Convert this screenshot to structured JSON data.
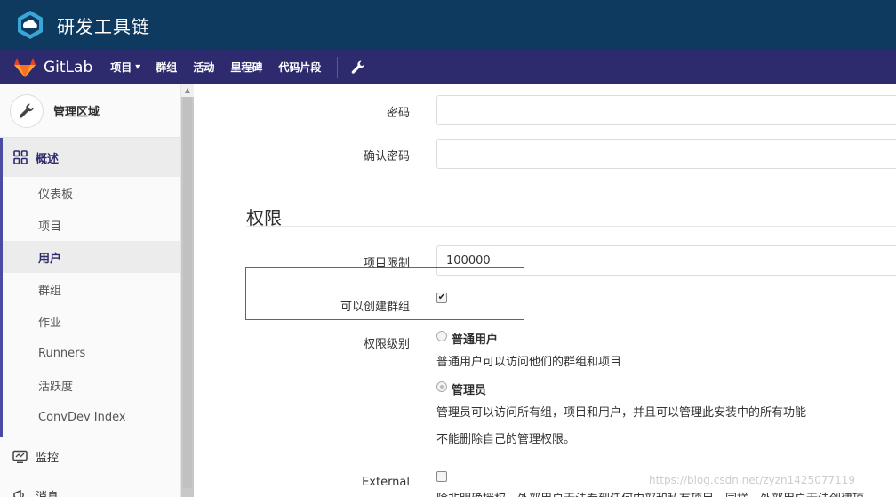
{
  "brand": {
    "title": "研发工具链",
    "logo_icon": "cloud-hexagon-icon"
  },
  "nav": {
    "app_name": "GitLab",
    "items": [
      {
        "label": "项目",
        "has_dropdown": true
      },
      {
        "label": "群组"
      },
      {
        "label": "活动"
      },
      {
        "label": "里程碑"
      },
      {
        "label": "代码片段"
      }
    ],
    "admin_icon": "wrench-icon",
    "colors": {
      "brandbar": "#0d3a5e",
      "navbar": "#2d2a6e"
    }
  },
  "sidebar": {
    "header": {
      "title": "管理区域",
      "icon": "wrench-icon"
    },
    "overview": {
      "label": "概述",
      "icon": "grid-icon",
      "items": [
        {
          "label": "仪表板"
        },
        {
          "label": "项目"
        },
        {
          "label": "用户",
          "active": true
        },
        {
          "label": "群组"
        },
        {
          "label": "作业"
        },
        {
          "label": "Runners"
        },
        {
          "label": "活跃度"
        },
        {
          "label": "ConvDev Index"
        }
      ]
    },
    "monitor": {
      "label": "监控",
      "icon": "monitor-icon"
    },
    "messages": {
      "label": "消息",
      "icon": "broadcast-icon"
    }
  },
  "form": {
    "password": {
      "label": "密码",
      "value": ""
    },
    "password_confirm": {
      "label": "确认密码",
      "value": ""
    },
    "section_title": "权限",
    "projects_limit": {
      "label": "项目限制",
      "value": "100000"
    },
    "can_create_group": {
      "label": "可以创建群组",
      "checked": true
    },
    "access_level": {
      "label": "权限级别",
      "regular": {
        "title": "普通用户",
        "help": "普通用户可以访问他们的群组和项目",
        "selected": false
      },
      "admin": {
        "title": "管理员",
        "help": "管理员可以访问所有组，项目和用户，并且可以管理此安装中的所有功能",
        "note": "不能删除自己的管理权限。",
        "selected": true
      }
    },
    "external": {
      "label": "External",
      "checked": false,
      "help": "除非明确授权，外部用户无法看到任何内部和私有项目。同样，外部用户无法创建项"
    }
  },
  "watermark": "https://blog.csdn.net/zyzn1425077119"
}
